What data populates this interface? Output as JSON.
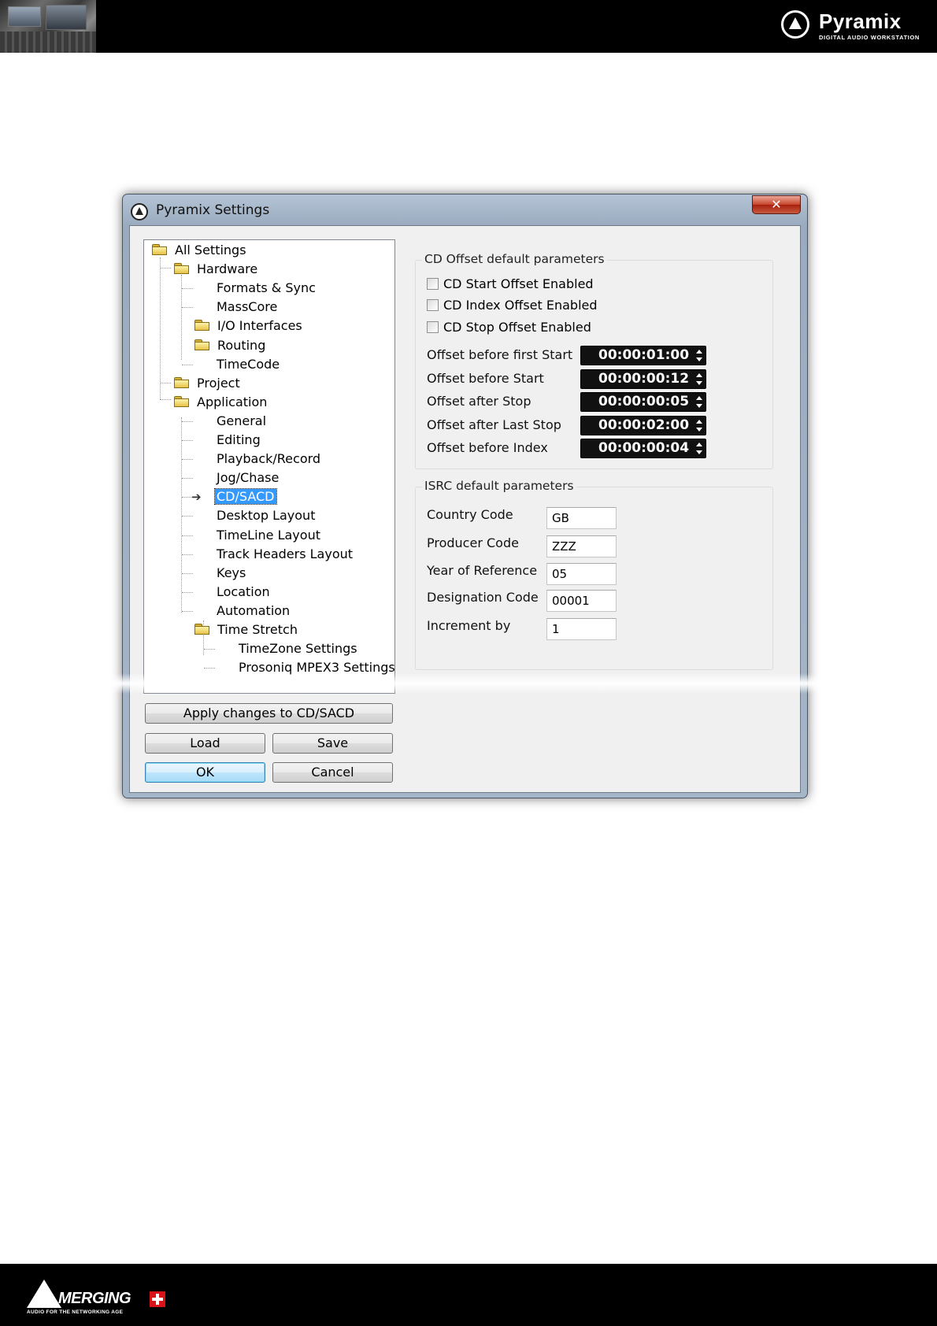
{
  "header": {
    "brand_name": "Pyramix",
    "brand_tagline": "DIGITAL AUDIO WORKSTATION"
  },
  "footer": {
    "brand_name": "MERGING",
    "brand_tagline": "AUDIO FOR THE NETWORKING AGE"
  },
  "dialog": {
    "title": "Pyramix Settings",
    "close_label": "✕",
    "tree": [
      {
        "label": "All Settings",
        "folder": true
      },
      {
        "label": "Hardware",
        "folder": true
      },
      {
        "label": "Formats & Sync",
        "folder": false
      },
      {
        "label": "MassCore",
        "folder": false
      },
      {
        "label": "I/O Interfaces",
        "folder": true
      },
      {
        "label": "Routing",
        "folder": true
      },
      {
        "label": "TimeCode",
        "folder": false
      },
      {
        "label": "Project",
        "folder": true
      },
      {
        "label": "Application",
        "folder": true
      },
      {
        "label": "General",
        "folder": false
      },
      {
        "label": "Editing",
        "folder": false
      },
      {
        "label": "Playback/Record",
        "folder": false
      },
      {
        "label": "Jog/Chase",
        "folder": false
      },
      {
        "label": "CD/SACD",
        "folder": false,
        "selected": true
      },
      {
        "label": "Desktop Layout",
        "folder": false
      },
      {
        "label": "TimeLine Layout",
        "folder": false
      },
      {
        "label": "Track Headers Layout",
        "folder": false
      },
      {
        "label": "Keys",
        "folder": false
      },
      {
        "label": "Location",
        "folder": false
      },
      {
        "label": "Automation",
        "folder": false
      },
      {
        "label": "Time Stretch",
        "folder": true
      },
      {
        "label": "TimeZone Settings",
        "folder": false
      },
      {
        "label": "Prosoniq MPEX3 Settings",
        "folder": false
      }
    ],
    "buttons": {
      "apply": "Apply changes to CD/SACD",
      "load": "Load",
      "save": "Save",
      "ok": "OK",
      "cancel": "Cancel"
    },
    "cd_offset": {
      "title": "CD Offset default parameters",
      "checkboxes": [
        {
          "label": "CD Start Offset Enabled",
          "checked": false
        },
        {
          "label": "CD Index Offset Enabled",
          "checked": false
        },
        {
          "label": "CD Stop Offset Enabled",
          "checked": false
        }
      ],
      "fields": [
        {
          "label": "Offset before first Start",
          "value": "00:00:01:00"
        },
        {
          "label": "Offset before Start",
          "value": "00:00:00:12"
        },
        {
          "label": "Offset after Stop",
          "value": "00:00:00:05"
        },
        {
          "label": "Offset after Last Stop",
          "value": "00:00:02:00"
        },
        {
          "label": "Offset before Index",
          "value": "00:00:00:04"
        }
      ]
    },
    "isrc": {
      "title": "ISRC default parameters",
      "fields": [
        {
          "label": "Country Code",
          "value": "GB"
        },
        {
          "label": "Producer Code",
          "value": "ZZZ"
        },
        {
          "label": "Year of Reference",
          "value": "05"
        },
        {
          "label": "Designation Code",
          "value": "00001"
        },
        {
          "label": "Increment by",
          "value": "1"
        }
      ]
    }
  }
}
